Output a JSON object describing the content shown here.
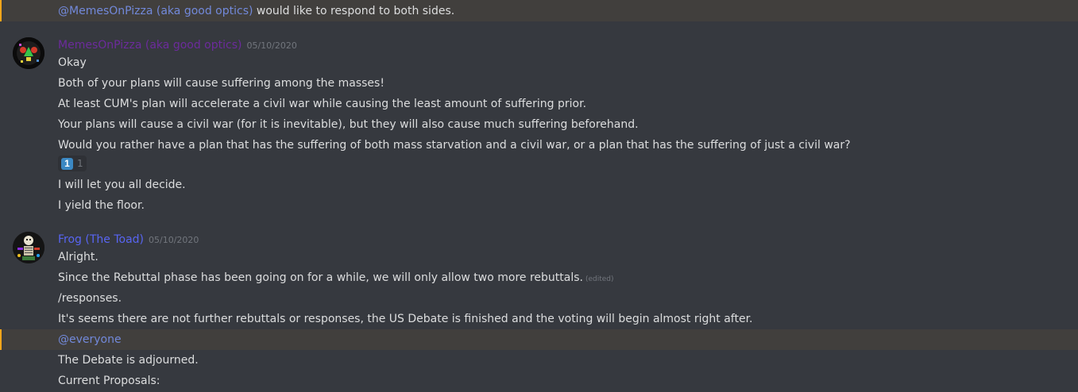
{
  "colors": {
    "background": "#36393f",
    "mention_highlight": "#faa61a",
    "mention_text": "#7289da",
    "author_1": "#6c2b9c",
    "author_2": "#5865f2"
  },
  "top_message": {
    "mention": "@MemesOnPizza (aka good optics)",
    "text": " would like to respond to both sides."
  },
  "messages": [
    {
      "author": "MemesOnPizza (aka good optics)",
      "timestamp": "05/10/2020",
      "avatar_icon": "pixel-art-avatar",
      "lines": [
        "Okay",
        "Both of your plans will cause suffering among the masses!",
        "At least CUM's plan will accelerate a civil war while causing the least amount of suffering prior.",
        "Your plans will cause a civil war (for it is inevitable), but they will also cause much suffering beforehand.",
        "Would you rather have a plan that has the suffering of both mass starvation and a civil war, or a plan that has the suffering of just a civil war?"
      ],
      "reaction": {
        "emoji": "1",
        "icon": "keycap-one-icon",
        "count": "1"
      },
      "after_lines": [
        "I will let you all decide.",
        "I yield the floor."
      ]
    },
    {
      "author": "Frog (The Toad)",
      "timestamp": "05/10/2020",
      "avatar_icon": "skeleton-avatar",
      "lines": [
        "Alright.",
        "Since the Rebuttal phase has been going on for a while, we will only allow two more rebuttals.",
        "/responses.",
        "It's seems there are not further rebuttals or responses, the US Debate is finished and the voting will begin almost right after."
      ],
      "edited_label": "(edited)",
      "mention_line": "@everyone",
      "after_lines": [
        "The Debate is adjourned.",
        "Current Proposals:"
      ]
    }
  ]
}
